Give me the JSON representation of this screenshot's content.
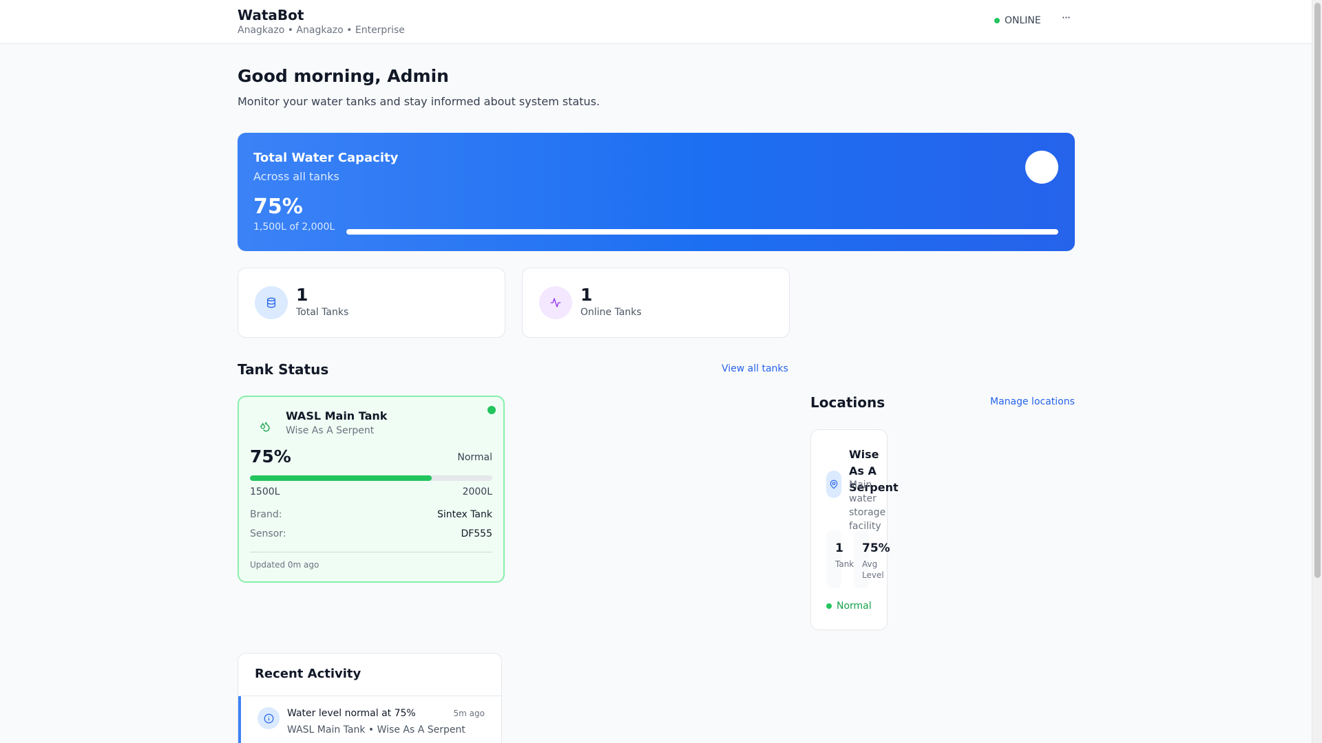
{
  "header": {
    "app_title": "WataBot",
    "subtitle": "Anagkazo • Anagkazo • Enterprise",
    "status_label": "ONLINE",
    "more_label": "···"
  },
  "welcome": {
    "greeting": "Good morning, Admin",
    "subtitle": "Monitor your water tanks and stay informed about system status."
  },
  "capacity": {
    "title": "Total Water Capacity",
    "subtitle": "Across all tanks",
    "percent_label": "75%",
    "amount_label": "1,500L of 2,000L",
    "fill_fraction": 1.0
  },
  "stats": [
    {
      "value": "1",
      "label": "Total Tanks",
      "icon": "database-icon"
    },
    {
      "value": "1",
      "label": "Online Tanks",
      "icon": "activity-icon"
    }
  ],
  "tank_status": {
    "title": "Tank Status",
    "view_all_label": "View all tanks"
  },
  "tanks": [
    {
      "name": "WASL Main Tank",
      "location": "Wise As A Serpent",
      "percent_label": "75%",
      "level_fraction": 0.75,
      "state": "Normal",
      "current_volume": "1500L",
      "capacity": "2000L",
      "brand_label": "Brand:",
      "brand": "Sintex Tank",
      "sensor_label": "Sensor:",
      "sensor": "DF555",
      "updated": "Updated 0m ago",
      "icon": "droplets-icon"
    }
  ],
  "locations": {
    "title": "Locations",
    "manage_label": "Manage locations",
    "items": [
      {
        "name": "Wise As A Serpent",
        "description": "Main water storage facility",
        "tank_count": "1",
        "tank_label": "Tank",
        "avg_level": "75%",
        "avg_label": "Avg Level",
        "status": "Normal",
        "icon": "map-pin-icon"
      }
    ]
  },
  "activity": {
    "title": "Recent Activity",
    "items": [
      {
        "message": "Water level normal at 75%",
        "time": "5m ago",
        "meta": "WASL Main Tank • Wise As A Serpent",
        "icon": "info-icon"
      }
    ]
  },
  "colors": {
    "accent_blue": "#2563eb",
    "status_green": "#22c55e",
    "tank_card_bg": "#f0fdf4",
    "tank_card_border": "#86efac"
  }
}
